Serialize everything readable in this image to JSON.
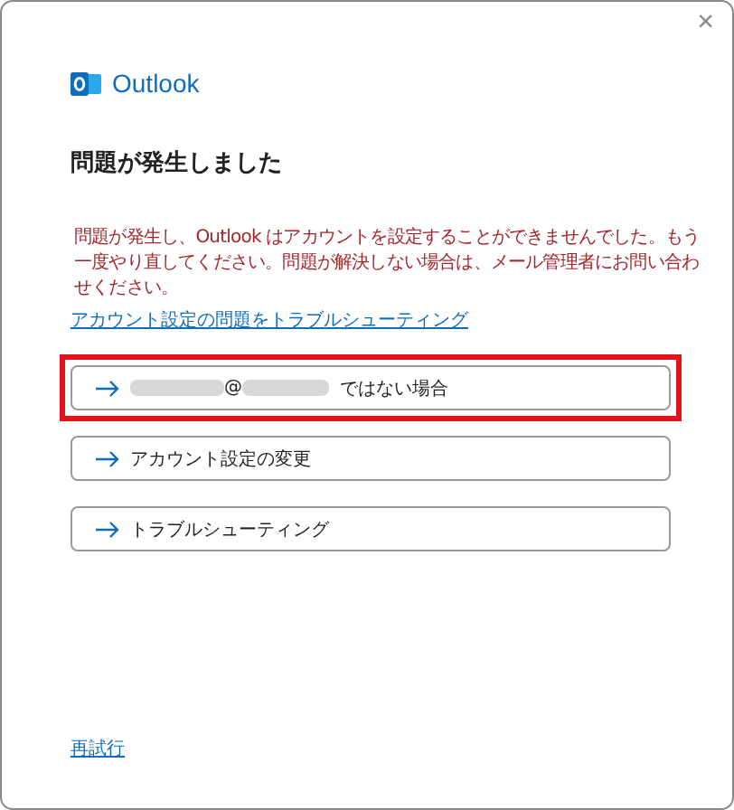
{
  "window": {
    "close": "×"
  },
  "brand": {
    "name": "Outlook"
  },
  "title": "問題が発生しました",
  "error_message": "問題が発生し、Outlook はアカウントを設定することができませんでした。もう一度やり直してください。問題が解決しない場合は、メール管理者にお問い合わせください。",
  "troubleshoot_link": "アカウント設定の問題をトラブルシューティング",
  "options": [
    {
      "kind": "account",
      "at": "@",
      "label": "ではない場合",
      "highlighted": true
    },
    {
      "kind": "plain",
      "label": "アカウント設定の変更",
      "highlighted": false
    },
    {
      "kind": "plain",
      "label": "トラブルシューティング",
      "highlighted": false
    }
  ],
  "retry_link": "再試行"
}
